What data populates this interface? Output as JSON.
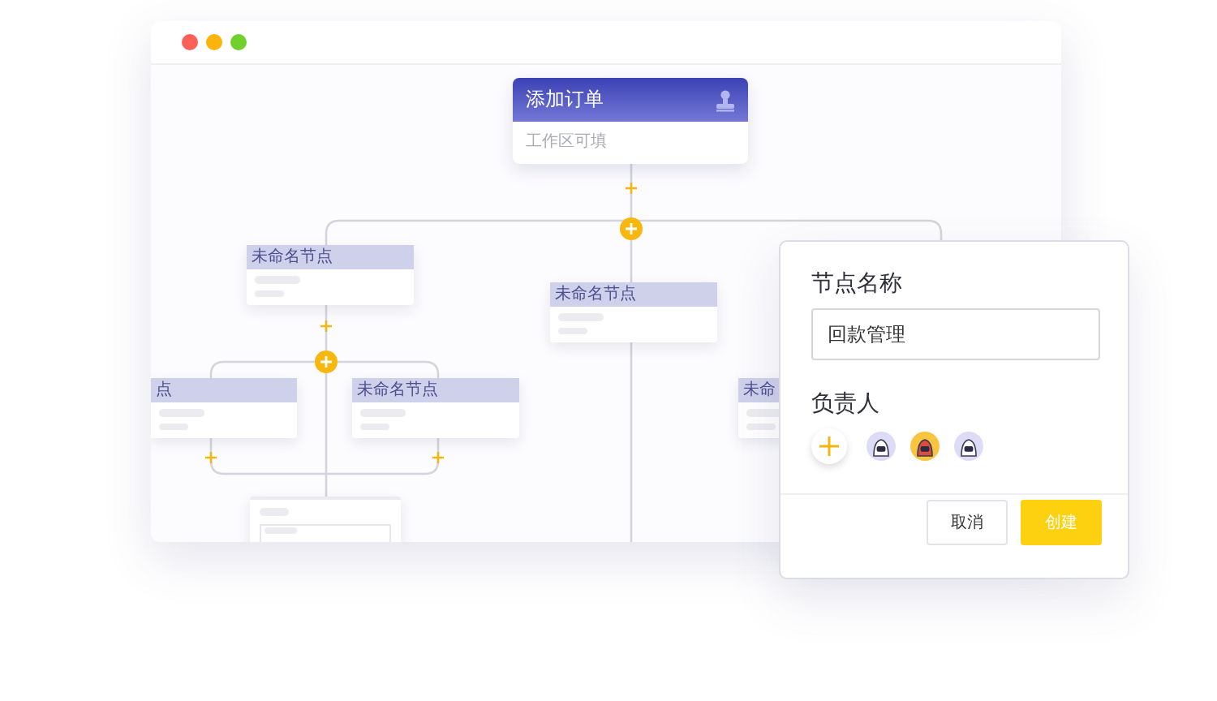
{
  "flow": {
    "nodes": [
      {
        "kind": "root",
        "title": "添加订单",
        "subtitle": "工作区可填"
      },
      {
        "kind": "node",
        "title": "未命名节点"
      },
      {
        "kind": "node",
        "title": "未命名节点"
      },
      {
        "kind": "node",
        "title": "点"
      },
      {
        "kind": "node",
        "title": "未命名节点"
      },
      {
        "kind": "node",
        "title": "未命"
      },
      {
        "kind": "form"
      }
    ]
  },
  "dialog": {
    "name_label": "节点名称",
    "name_value": "回款管理",
    "owner_label": "负责人",
    "avatars": [
      {
        "selected": false
      },
      {
        "selected": true
      },
      {
        "selected": false
      }
    ],
    "buttons": [
      {
        "label": "取消",
        "kind": "secondary"
      },
      {
        "label": "创建",
        "kind": "primary"
      }
    ]
  }
}
